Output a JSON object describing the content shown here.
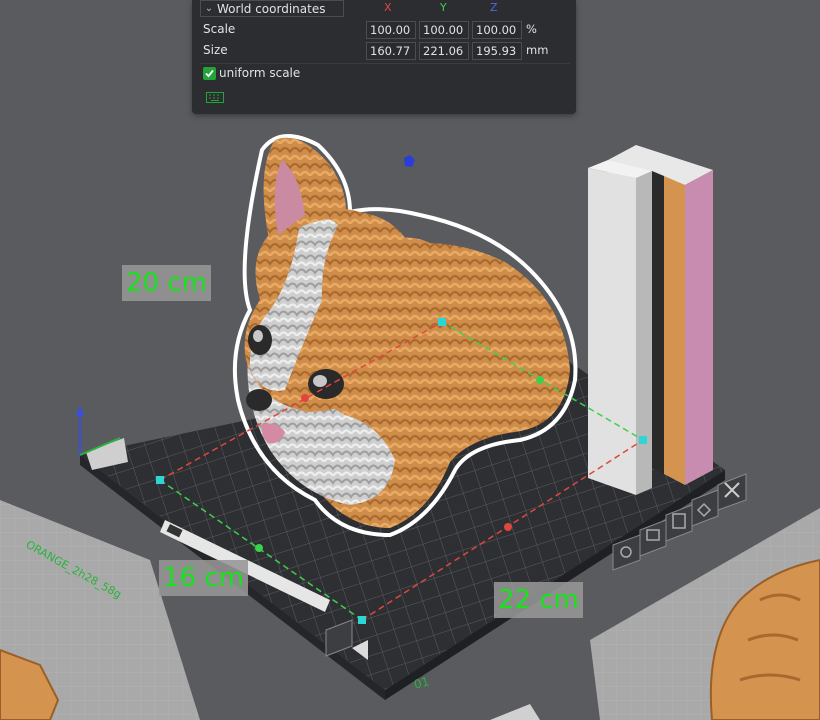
{
  "gizmo_panel": {
    "coordinate_system": "World coordinates",
    "axis_labels": {
      "x": "X",
      "y": "Y",
      "z": "Z"
    },
    "scale": {
      "label": "Scale",
      "x": "100.00",
      "y": "100.00",
      "z": "100.00",
      "unit": "%"
    },
    "size": {
      "label": "Size",
      "x": "160.77",
      "y": "221.06",
      "z": "195.93",
      "unit": "mm"
    },
    "uniform_scale": {
      "label": "uniform scale",
      "checked": true
    },
    "keyboard_icon": "keyboard-icon"
  },
  "dimensions": {
    "height": "20 cm",
    "width": "16 cm",
    "depth": "22 cm"
  },
  "plate": {
    "name": "ORANGE_2h28_58g",
    "number": "01"
  },
  "colors": {
    "accent_green": "#23a43b",
    "axis_x": "#e0463f",
    "axis_y": "#3bd14c",
    "axis_z": "#4e68e6",
    "model_orange": "#d4934e",
    "model_white": "#d9d9d9"
  }
}
